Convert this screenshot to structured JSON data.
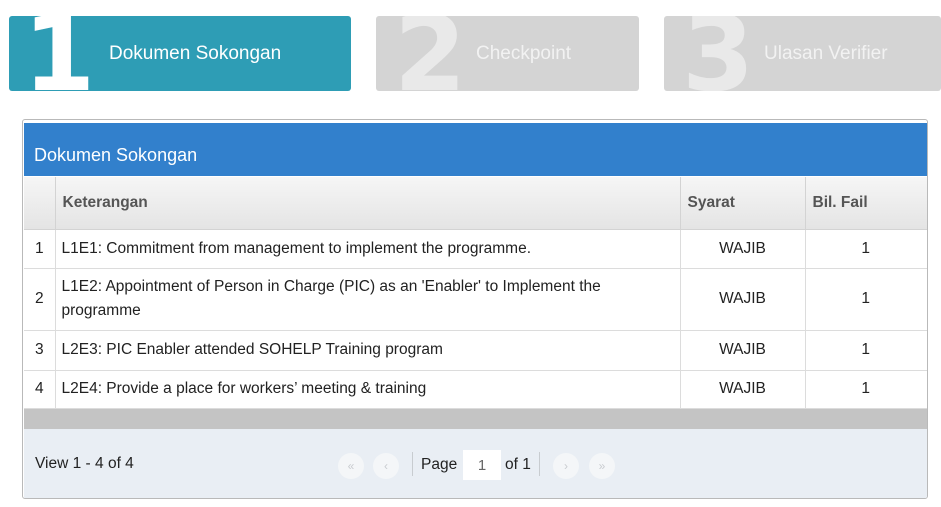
{
  "steps": [
    {
      "number": "1",
      "label": "Dokumen Sokongan"
    },
    {
      "number": "2",
      "label": "Checkpoint"
    },
    {
      "number": "3",
      "label": "Ulasan Verifier"
    }
  ],
  "panel": {
    "title": "Dokumen Sokongan",
    "columns": [
      "",
      "Keterangan",
      "Syarat",
      "Bil. Fail"
    ],
    "rows": [
      {
        "no": "1",
        "keterangan": "L1E1: Commitment from management to implement the programme.",
        "syarat": "WAJIB",
        "bil": "1"
      },
      {
        "no": "2",
        "keterangan": "L1E2: Appointment of Person in Charge (PIC) as an 'Enabler' to Implement the programme",
        "syarat": "WAJIB",
        "bil": "1"
      },
      {
        "no": "3",
        "keterangan": "L2E3: PIC Enabler attended SOHELP Training program",
        "syarat": "WAJIB",
        "bil": "1"
      },
      {
        "no": "4",
        "keterangan": "L2E4: Provide a place for workers’ meeting & training",
        "syarat": "WAJIB",
        "bil": "1"
      }
    ]
  },
  "pager": {
    "view_text": "View 1 - 4 of 4",
    "page_label": "Page",
    "page_value": "1",
    "of_label": "of 1",
    "icons": [
      "first-page-icon",
      "prev-page-icon",
      "next-page-icon",
      "last-page-icon"
    ]
  },
  "colors": {
    "active_step": "#2e9db5",
    "inactive_step": "#d4d4d4",
    "panel_header": "#3280cc"
  }
}
